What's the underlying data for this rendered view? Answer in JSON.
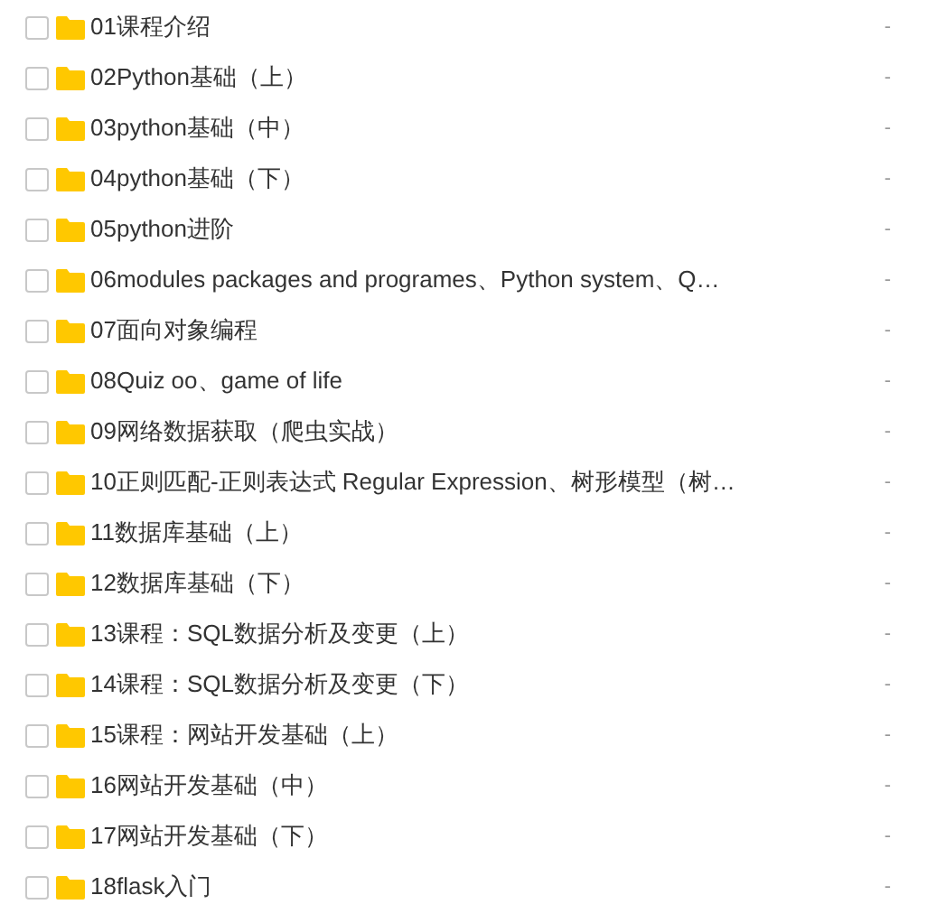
{
  "files": [
    {
      "name": "01课程介绍",
      "checked": false,
      "size": "-"
    },
    {
      "name": "02Python基础（上）",
      "checked": false,
      "size": "-"
    },
    {
      "name": "03python基础（中）",
      "checked": false,
      "size": "-"
    },
    {
      "name": "04python基础（下）",
      "checked": false,
      "size": "-"
    },
    {
      "name": "05python进阶",
      "checked": false,
      "size": "-"
    },
    {
      "name": "06modules packages and programes、Python system、Q…",
      "checked": false,
      "size": "-"
    },
    {
      "name": "07面向对象编程",
      "checked": false,
      "size": "-"
    },
    {
      "name": "08Quiz oo、game of life",
      "checked": false,
      "size": "-"
    },
    {
      "name": "09网络数据获取（爬虫实战）",
      "checked": false,
      "size": "-"
    },
    {
      "name": "10正则匹配-正则表达式 Regular Expression、树形模型（树…",
      "checked": false,
      "size": "-"
    },
    {
      "name": "11数据库基础（上）",
      "checked": false,
      "size": "-"
    },
    {
      "name": "12数据库基础（下）",
      "checked": false,
      "size": "-"
    },
    {
      "name": "13课程：SQL数据分析及变更（上）",
      "checked": false,
      "size": "-"
    },
    {
      "name": "14课程：SQL数据分析及变更（下）",
      "checked": false,
      "size": "-"
    },
    {
      "name": "15课程：网站开发基础（上）",
      "checked": false,
      "size": "-"
    },
    {
      "name": "16网站开发基础（中）",
      "checked": false,
      "size": "-"
    },
    {
      "name": "17网站开发基础（下）",
      "checked": false,
      "size": "-"
    },
    {
      "name": "18flask入门",
      "checked": false,
      "size": "-"
    }
  ]
}
